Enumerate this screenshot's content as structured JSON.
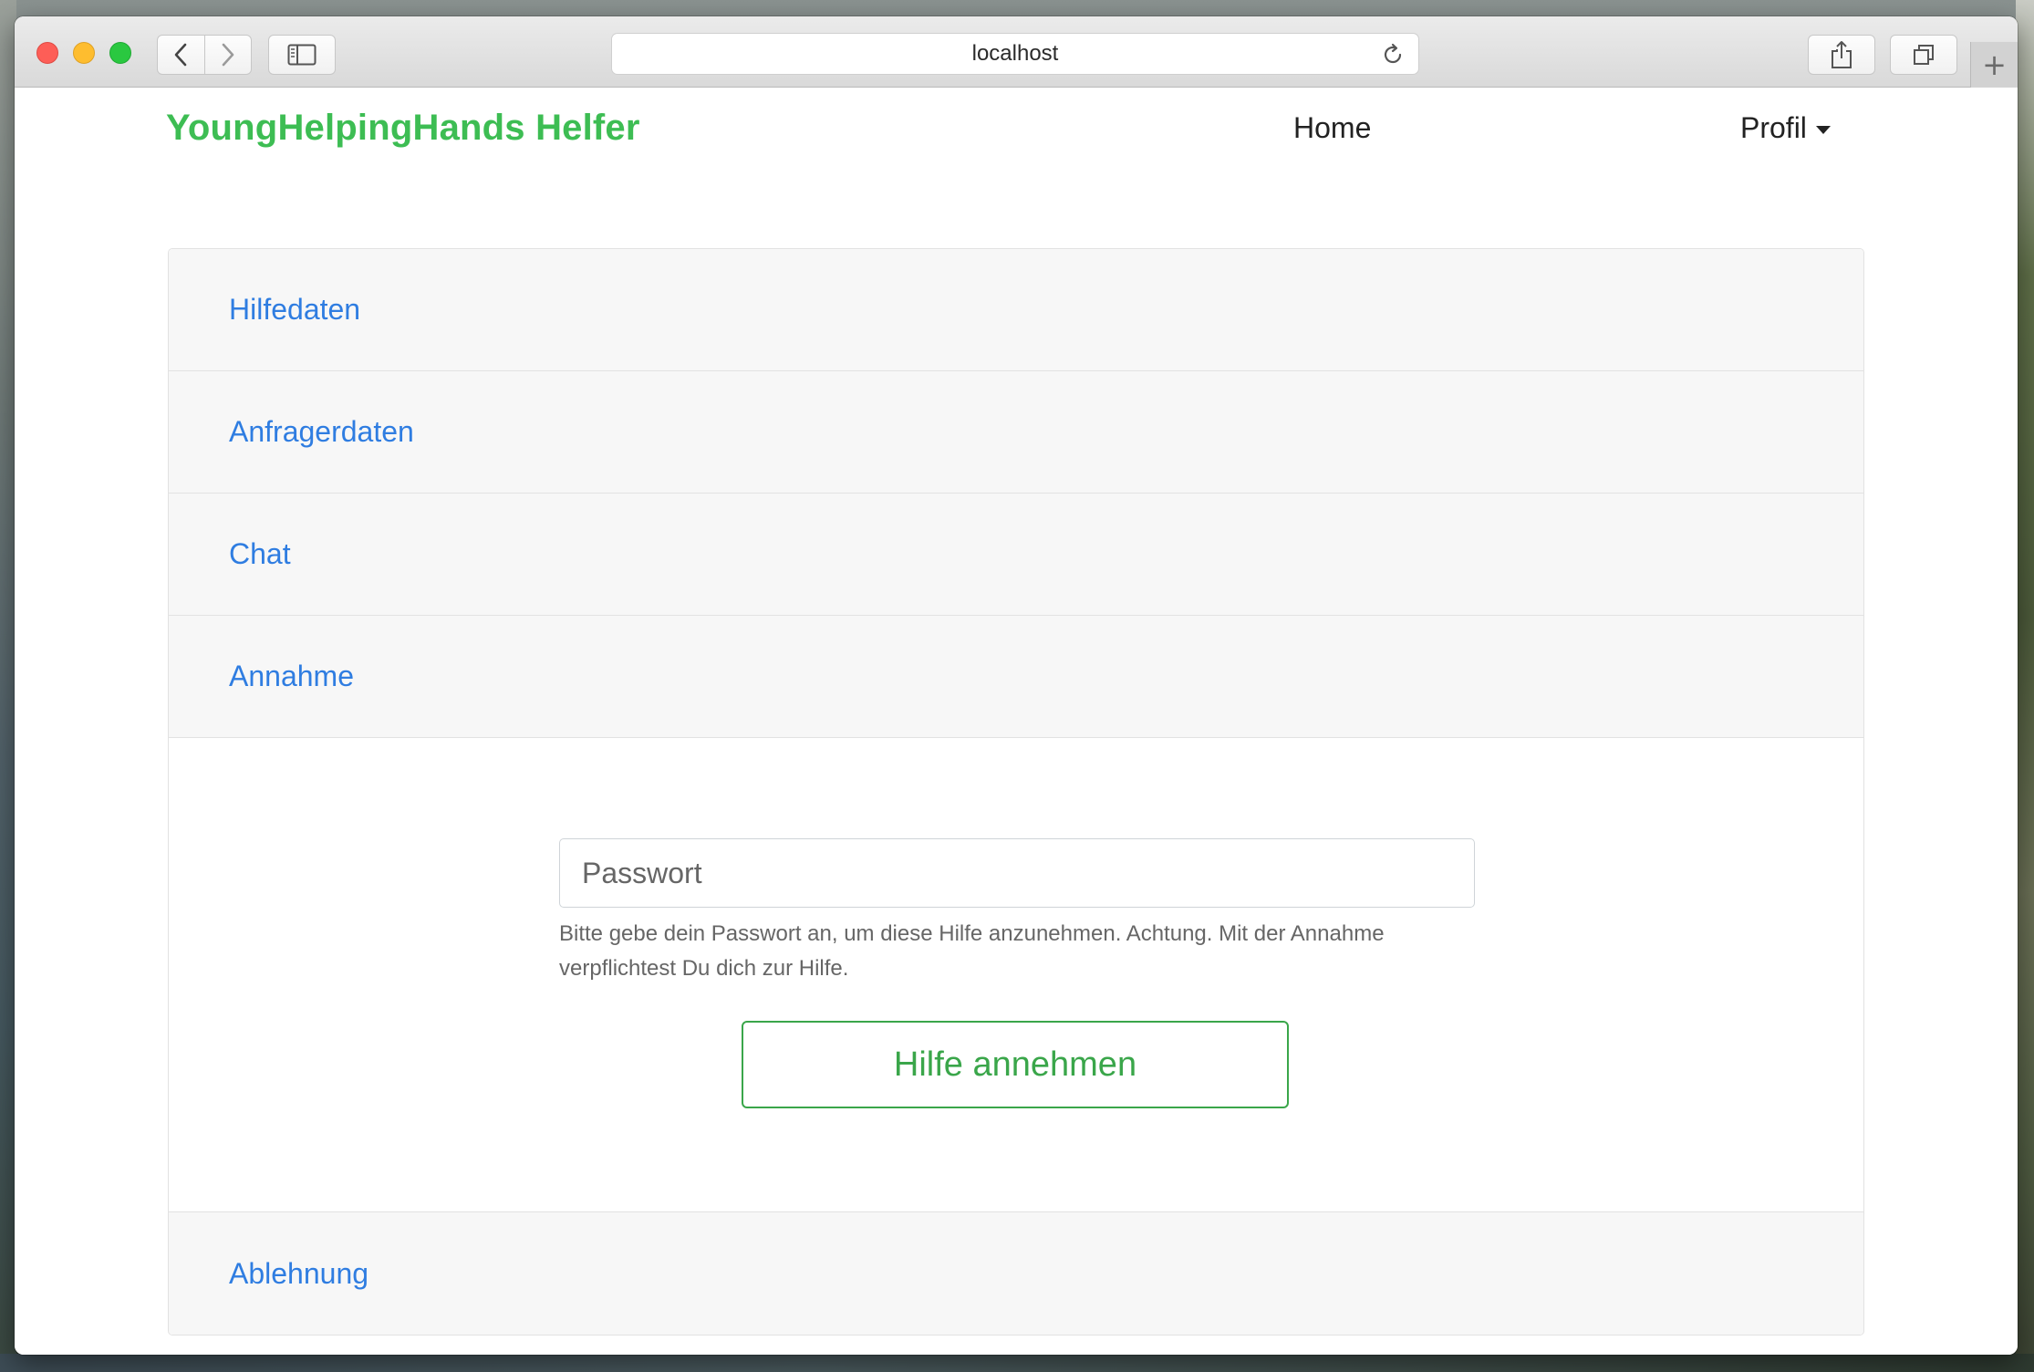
{
  "browser": {
    "url": "localhost",
    "new_tab_symbol": "+"
  },
  "navbar": {
    "brand": "YoungHelpingHands Helfer",
    "home": "Home",
    "profile": "Profil"
  },
  "accordion": {
    "sections": [
      {
        "label": "Hilfedaten"
      },
      {
        "label": "Anfragerdaten"
      },
      {
        "label": "Chat"
      },
      {
        "label": "Annahme"
      }
    ],
    "last_section": "Ablehnung"
  },
  "annahme": {
    "password_placeholder": "Passwort",
    "help_text": "Bitte gebe dein Passwort an, um diese Hilfe anzunehmen. Achtung. Mit der Annahme verpflichtest Du dich zur Hilfe.",
    "accept_button": "Hilfe annehmen"
  },
  "colors": {
    "brand": "#3dbd53",
    "link": "#2f7de1",
    "accept": "#3aa64a"
  }
}
